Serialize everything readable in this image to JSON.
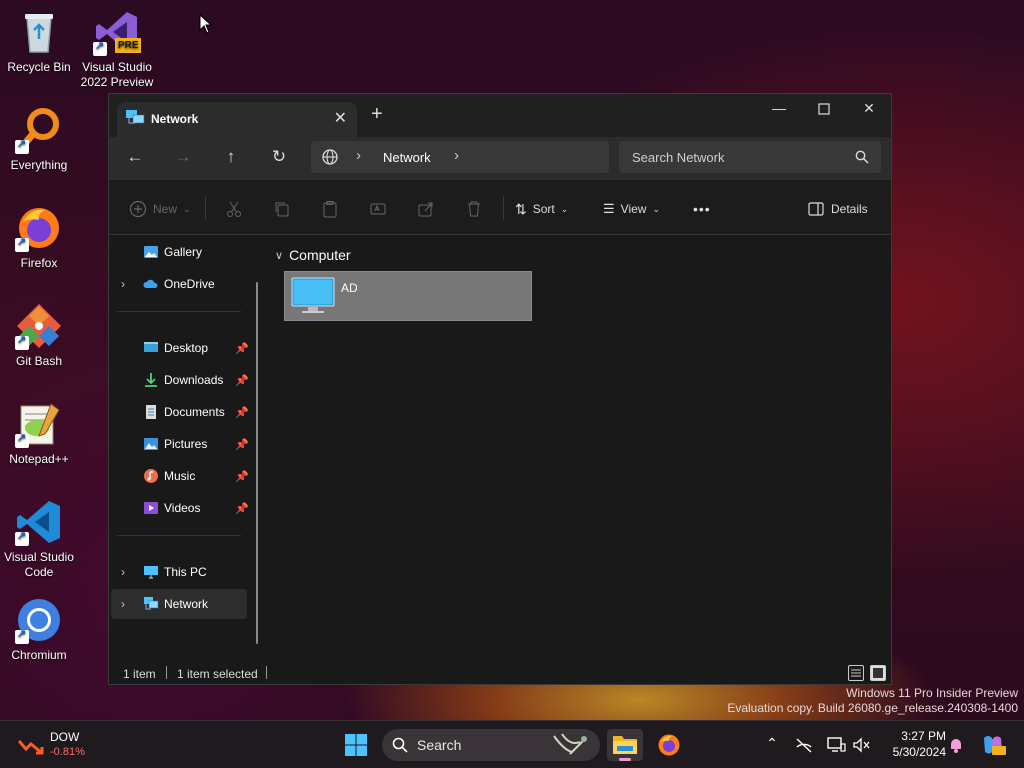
{
  "desktop": {
    "icons": [
      {
        "label": "Recycle Bin",
        "icon": "recycle-bin-icon"
      },
      {
        "label": "Visual Studio 2022 Preview",
        "badge": "PRE",
        "icon": "visual-studio-icon"
      },
      {
        "label": "Everything",
        "icon": "everything-icon"
      },
      {
        "label": "Firefox",
        "icon": "firefox-icon"
      },
      {
        "label": "Git Bash",
        "icon": "git-bash-icon"
      },
      {
        "label": "Notepad++",
        "icon": "notepad-plus-plus-icon"
      },
      {
        "label": "Visual Studio Code",
        "icon": "vscode-icon"
      },
      {
        "label": "Chromium",
        "icon": "chromium-icon"
      }
    ]
  },
  "explorer": {
    "tab_title": "Network",
    "address": {
      "crumb": "Network"
    },
    "search_placeholder": "Search Network",
    "toolbar": {
      "new_label": "New",
      "sort_label": "Sort",
      "view_label": "View",
      "more_label": "•••",
      "details_label": "Details"
    },
    "sidebar": {
      "top": [
        {
          "label": "Gallery",
          "icon": "gallery-icon"
        },
        {
          "label": "OneDrive",
          "icon": "onedrive-icon",
          "expandable": true
        }
      ],
      "pinned": [
        {
          "label": "Desktop",
          "icon": "desktop-folder-icon"
        },
        {
          "label": "Downloads",
          "icon": "downloads-icon"
        },
        {
          "label": "Documents",
          "icon": "documents-icon"
        },
        {
          "label": "Pictures",
          "icon": "pictures-icon"
        },
        {
          "label": "Music",
          "icon": "music-icon"
        },
        {
          "label": "Videos",
          "icon": "videos-icon"
        }
      ],
      "bottom": [
        {
          "label": "This PC",
          "icon": "this-pc-icon"
        },
        {
          "label": "Network",
          "icon": "network-icon",
          "selected": true
        }
      ]
    },
    "content": {
      "group_title": "Computer",
      "items": [
        {
          "name": "AD",
          "icon": "computer-icon",
          "selected": true
        }
      ]
    },
    "status": {
      "count": "1 item",
      "selected": "1 item selected"
    }
  },
  "watermark": {
    "line1": "Windows 11 Pro Insider Preview",
    "line2": "Evaluation copy. Build 26080.ge_release.240308-1400"
  },
  "taskbar": {
    "widget": {
      "name": "DOW",
      "change": "-0.81%",
      "change_color": "#ff6b6b"
    },
    "search_placeholder": "Search",
    "clock": {
      "time": "3:27 PM",
      "date": "5/30/2024"
    }
  },
  "colors": {
    "accent": "#4cc2ff",
    "selection": "#777777"
  }
}
